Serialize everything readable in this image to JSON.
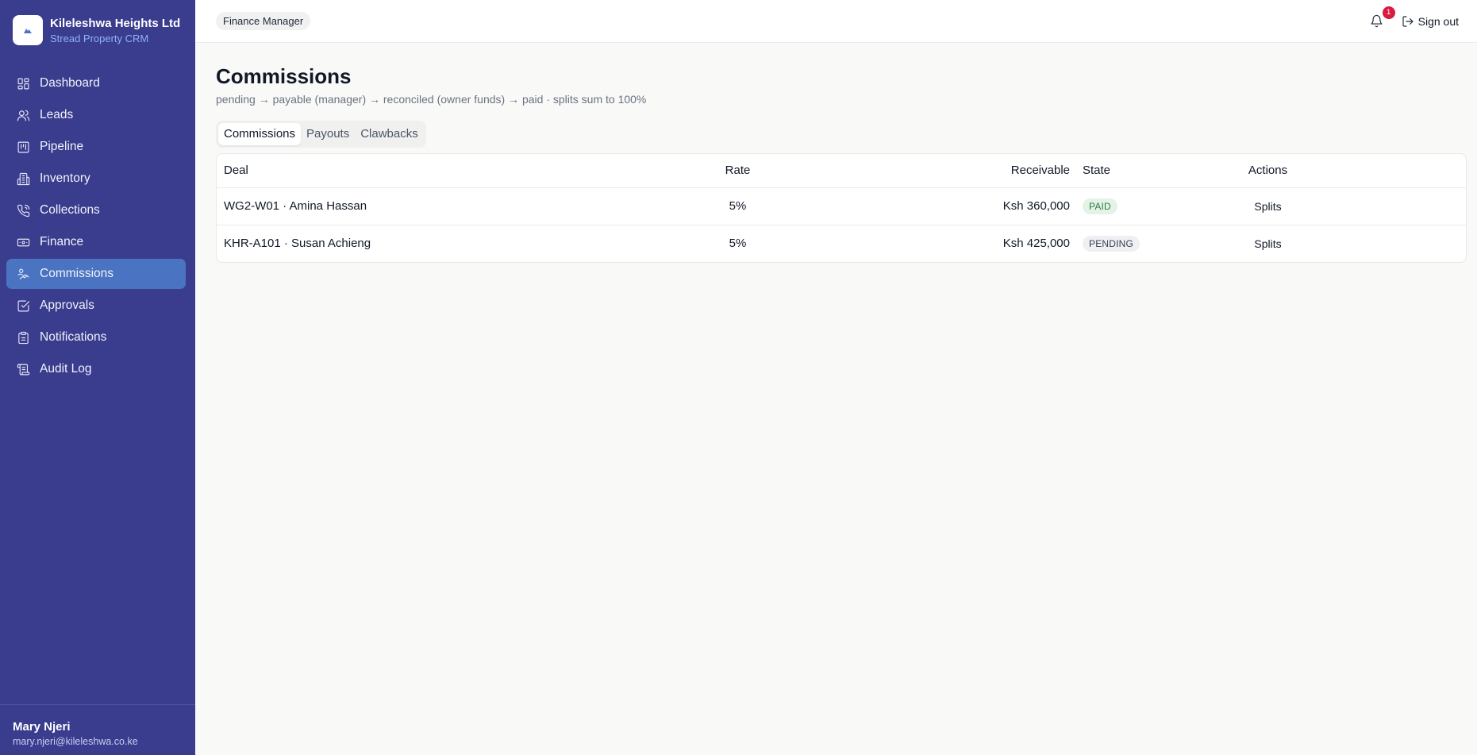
{
  "brand": {
    "name": "Kileleshwa Heights Ltd",
    "subtitle": "Stread Property CRM",
    "logo_icon": "building-logo-icon"
  },
  "sidebar": {
    "items": [
      {
        "label": "Dashboard",
        "icon": "dashboard-icon",
        "active": false
      },
      {
        "label": "Leads",
        "icon": "users-icon",
        "active": false
      },
      {
        "label": "Pipeline",
        "icon": "kanban-icon",
        "active": false
      },
      {
        "label": "Inventory",
        "icon": "building-icon",
        "active": false
      },
      {
        "label": "Collections",
        "icon": "phone-icon",
        "active": false
      },
      {
        "label": "Finance",
        "icon": "banknote-icon",
        "active": false
      },
      {
        "label": "Commissions",
        "icon": "handshake-icon",
        "active": true
      },
      {
        "label": "Approvals",
        "icon": "check-square-icon",
        "active": false
      },
      {
        "label": "Notifications",
        "icon": "clipboard-icon",
        "active": false
      },
      {
        "label": "Audit Log",
        "icon": "scroll-icon",
        "active": false
      }
    ],
    "active_color": "#4a74c2",
    "background": "#3a3c8e"
  },
  "user": {
    "name": "Mary Njeri",
    "email": "mary.njeri@kileleshwa.co.ke"
  },
  "topbar": {
    "role": "Finance Manager",
    "notification_count": "1",
    "signout_label": "Sign out"
  },
  "page": {
    "title": "Commissions",
    "subtitle": "pending → payable (manager) → reconciled (owner funds) → paid · splits sum to 100%"
  },
  "tabs": [
    {
      "label": "Commissions",
      "active": true
    },
    {
      "label": "Payouts",
      "active": false
    },
    {
      "label": "Clawbacks",
      "active": false
    }
  ],
  "table": {
    "columns": {
      "deal": "Deal",
      "rate": "Rate",
      "receivable": "Receivable",
      "state": "State",
      "actions": "Actions"
    },
    "rows": [
      {
        "deal": "WG2-W01 · Amina Hassan",
        "rate": "5%",
        "receivable": "Ksh 360,000",
        "state": "PAID",
        "action": "Splits"
      },
      {
        "deal": "KHR-A101 · Susan Achieng",
        "rate": "5%",
        "receivable": "Ksh 425,000",
        "state": "PENDING",
        "action": "Splits"
      }
    ]
  }
}
